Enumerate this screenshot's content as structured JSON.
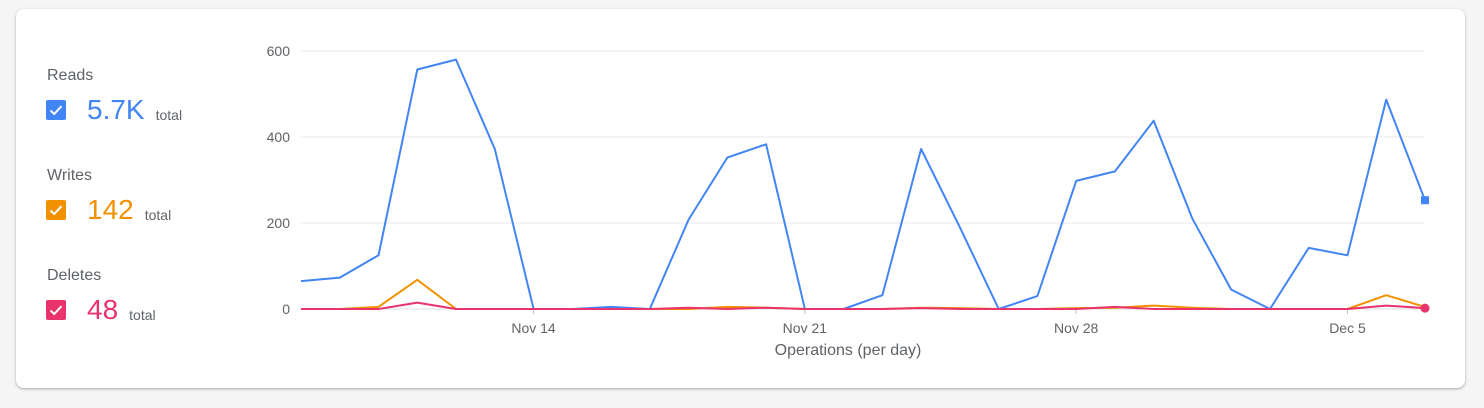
{
  "legend": [
    {
      "label": "Reads",
      "value": "5.7K",
      "suffix": "total",
      "color": "#4285f4"
    },
    {
      "label": "Writes",
      "value": "142",
      "suffix": "total",
      "color": "#f29100"
    },
    {
      "label": "Deletes",
      "value": "48",
      "suffix": "total",
      "color": "#e8336d"
    }
  ],
  "chart_data": {
    "type": "line",
    "xlabel": "Operations (per day)",
    "ylabel": "",
    "ylim": [
      0,
      600
    ],
    "yticks": [
      0,
      200,
      400,
      600
    ],
    "xticks": [
      {
        "index": 6,
        "label": "Nov 14"
      },
      {
        "index": 13,
        "label": "Nov 21"
      },
      {
        "index": 20,
        "label": "Nov 28"
      },
      {
        "index": 27,
        "label": "Dec 5"
      }
    ],
    "x": [
      "Nov 8",
      "Nov 9",
      "Nov 10",
      "Nov 11",
      "Nov 12",
      "Nov 13",
      "Nov 14",
      "Nov 15",
      "Nov 16",
      "Nov 17",
      "Nov 18",
      "Nov 19",
      "Nov 20",
      "Nov 21",
      "Nov 22",
      "Nov 23",
      "Nov 24",
      "Nov 25",
      "Nov 26",
      "Nov 27",
      "Nov 28",
      "Nov 29",
      "Nov 30",
      "Dec 1",
      "Dec 2",
      "Dec 3",
      "Dec 4",
      "Dec 5",
      "Dec 6",
      "Dec 7"
    ],
    "series": [
      {
        "name": "Reads",
        "color": "#4285f4",
        "values": [
          65,
          73,
          125,
          557,
          580,
          372,
          0,
          0,
          5,
          0,
          208,
          352,
          383,
          0,
          0,
          32,
          372,
          190,
          0,
          30,
          298,
          320,
          438,
          210,
          45,
          0,
          142,
          125,
          487,
          253
        ]
      },
      {
        "name": "Writes",
        "color": "#f29100",
        "values": [
          0,
          0,
          5,
          68,
          0,
          0,
          0,
          0,
          0,
          0,
          0,
          5,
          3,
          0,
          0,
          0,
          3,
          2,
          0,
          0,
          2,
          3,
          8,
          3,
          0,
          0,
          0,
          0,
          32,
          5
        ]
      },
      {
        "name": "Deletes",
        "color": "#e8336d",
        "values": [
          0,
          0,
          0,
          15,
          0,
          0,
          0,
          0,
          0,
          0,
          3,
          0,
          3,
          0,
          0,
          0,
          2,
          0,
          0,
          0,
          0,
          5,
          0,
          0,
          0,
          0,
          0,
          0,
          8,
          2
        ]
      }
    ],
    "grid": true
  }
}
